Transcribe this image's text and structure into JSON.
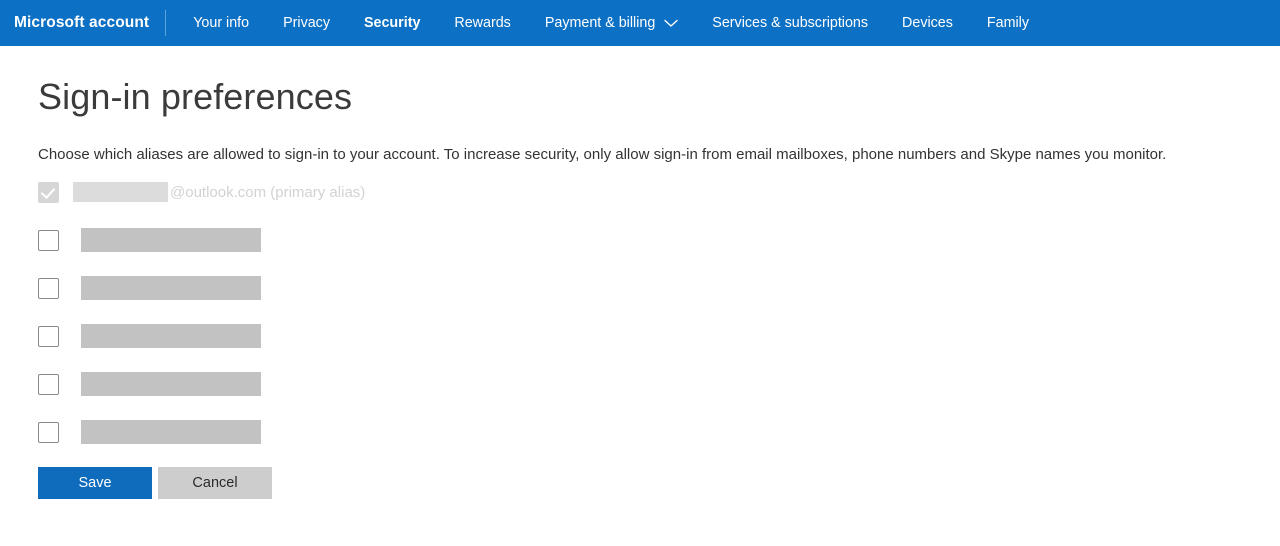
{
  "navbar": {
    "brand": "Microsoft account",
    "items": [
      {
        "label": "Your info",
        "active": false,
        "has_chevron": false
      },
      {
        "label": "Privacy",
        "active": false,
        "has_chevron": false
      },
      {
        "label": "Security",
        "active": true,
        "has_chevron": false
      },
      {
        "label": "Rewards",
        "active": false,
        "has_chevron": false
      },
      {
        "label": "Payment & billing",
        "active": false,
        "has_chevron": true
      },
      {
        "label": "Services & subscriptions",
        "active": false,
        "has_chevron": false
      },
      {
        "label": "Devices",
        "active": false,
        "has_chevron": false
      },
      {
        "label": "Family",
        "active": false,
        "has_chevron": false
      }
    ]
  },
  "page": {
    "title": "Sign-in preferences",
    "description": "Choose which aliases are allowed to sign-in to your account. To increase security, only allow sign-in from email mailboxes, phone numbers and Skype names you monitor."
  },
  "aliases": {
    "primary": {
      "checked": true,
      "disabled": true,
      "redacted_width": 95,
      "suffix": "@outlook.com (primary alias)"
    },
    "rows": [
      {
        "checked": false,
        "redacted_width": 180
      },
      {
        "checked": false,
        "redacted_width": 180
      },
      {
        "checked": false,
        "redacted_width": 180
      },
      {
        "checked": false,
        "redacted_width": 180
      },
      {
        "checked": false,
        "redacted_width": 180
      }
    ]
  },
  "buttons": {
    "save_label": "Save",
    "cancel_label": "Cancel"
  },
  "colors": {
    "nav_blue": "#0c70c4",
    "primary_button_blue": "#0f6cbd",
    "secondary_button_grey": "#cdcdcd",
    "redaction_grey": "#c2c2c2"
  }
}
